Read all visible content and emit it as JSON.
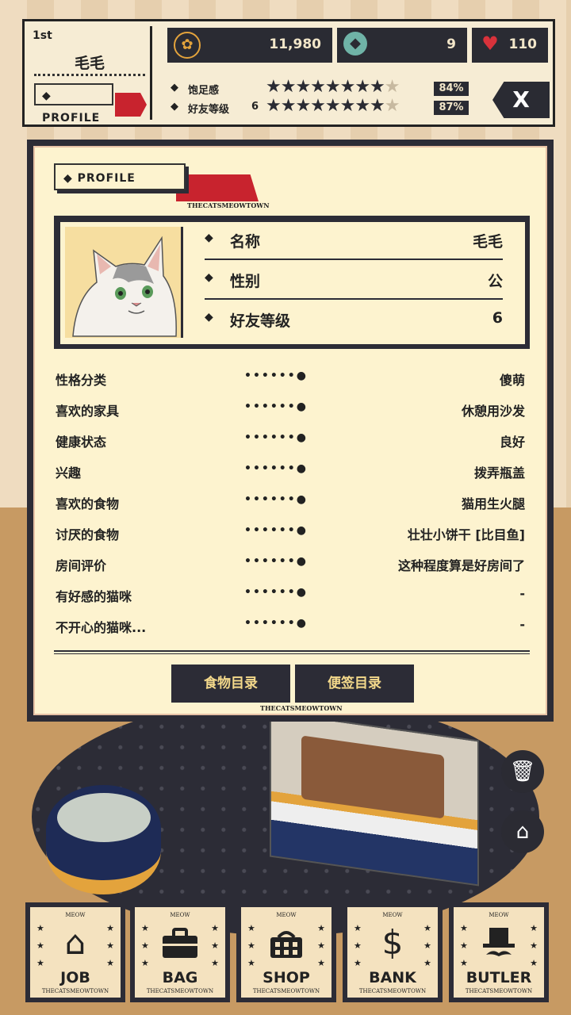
{
  "hud": {
    "rank": "1st",
    "cat_name": "毛毛",
    "profile_label": "◆ PROFILE",
    "coins": "11,980",
    "gems": "9",
    "hearts": "110",
    "satiety_label": "饱足感",
    "friend_level_label": "好友等级",
    "friend_level": "6",
    "satiety_pct": "84%",
    "friend_pct": "87%",
    "close_label": "X"
  },
  "panel": {
    "title": "◆ PROFILE",
    "brand": "THECATSMEOWTOWN",
    "info": [
      {
        "key": "名称",
        "value": "毛毛"
      },
      {
        "key": "性别",
        "value": "公"
      },
      {
        "key": "好友等级",
        "value": "6"
      }
    ],
    "attributes": [
      {
        "key": "性格分类",
        "value": "傻萌"
      },
      {
        "key": "喜欢的家具",
        "value": "休憩用沙发"
      },
      {
        "key": "健康状态",
        "value": "良好"
      },
      {
        "key": "兴趣",
        "value": "拨弄瓶盖"
      },
      {
        "key": "喜欢的食物",
        "value": "猫用生火腿"
      },
      {
        "key": "讨厌的食物",
        "value": "壮壮小饼干 [比目鱼]"
      },
      {
        "key": "房间评价",
        "value": "这种程度算是好房间了"
      },
      {
        "key": "有好感的猫咪",
        "value": "-"
      },
      {
        "key": "不开心的猫咪...",
        "value": "-"
      }
    ],
    "tabs": {
      "food": "食物目录",
      "notes": "便签目录"
    }
  },
  "menu": {
    "meow": "MEOW",
    "brand": "THECATSMEOWTOWN",
    "items": [
      {
        "label": "JOB",
        "icon": "house-icon"
      },
      {
        "label": "BAG",
        "icon": "suitcase-icon"
      },
      {
        "label": "SHOP",
        "icon": "basket-icon"
      },
      {
        "label": "BANK",
        "icon": "dollar-icon"
      },
      {
        "label": "BUTLER",
        "icon": "tophat-icon"
      }
    ]
  },
  "colors": {
    "dark": "#2c2c36",
    "accent_red": "#c8232e",
    "panel_bg": "#fdf3cf"
  }
}
